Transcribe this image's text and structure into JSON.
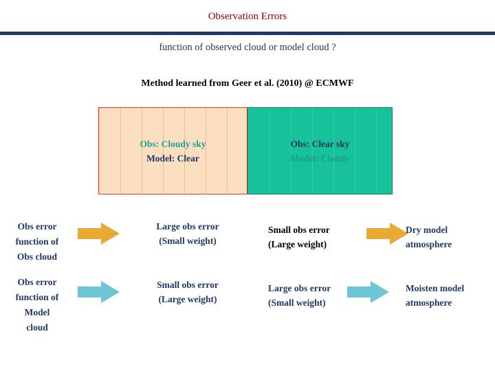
{
  "slide": {
    "title": "Observation Errors",
    "subtitle": "function of observed cloud or model cloud ?",
    "method": "Method learned from  Geer et al. (2010) @ ECMWF"
  },
  "colors": {
    "title_red": "#8b0000",
    "rule_navy": "#1f3864",
    "cloudy_fill": "#fbdfc0",
    "cloudy_border": "#e8392a",
    "clear_fill": "#17c29b",
    "clear_border": "#0d7d64",
    "teal_text": "#17a39b",
    "navy_text": "#1f3864",
    "arrow_gold": "#e8a935",
    "arrow_blue": "#6cc6d4"
  },
  "boxes": [
    {
      "name": "cloudy-obs-clear-model",
      "line1": "Obs: Cloudy sky",
      "line2": "Model: Clear"
    },
    {
      "name": "clear-obs-cloudy-model",
      "line1": "Obs: Clear sky",
      "line2": "Model: Cloudy"
    }
  ],
  "rows": [
    {
      "label": "Obs error\nfunction of\nObs cloud",
      "label_lines": [
        "Obs error",
        "function of",
        "Obs cloud"
      ],
      "arrow_left_icon": "right-arrow-icon",
      "cell1_line1": "Large obs error",
      "cell1_line2": "(Small weight)",
      "cell2_line1": "Small obs error",
      "cell2_line2": "(Large weight)",
      "arrow_right_icon": "right-arrow-icon",
      "cell3_line1": "Dry model",
      "cell3_line2": "atmosphere"
    },
    {
      "label_lines": [
        "Obs error",
        "function of",
        "Model",
        "cloud"
      ],
      "arrow_left_icon": "right-arrow-icon",
      "cell1_line1": "Small obs error",
      "cell1_line2": "(Large weight)",
      "cell2_line1": "Large obs error",
      "cell2_line2": "(Small weight)",
      "arrow_right_icon": "right-arrow-icon",
      "cell3_line1": "Moisten model",
      "cell3_line2": "atmosphere"
    }
  ]
}
